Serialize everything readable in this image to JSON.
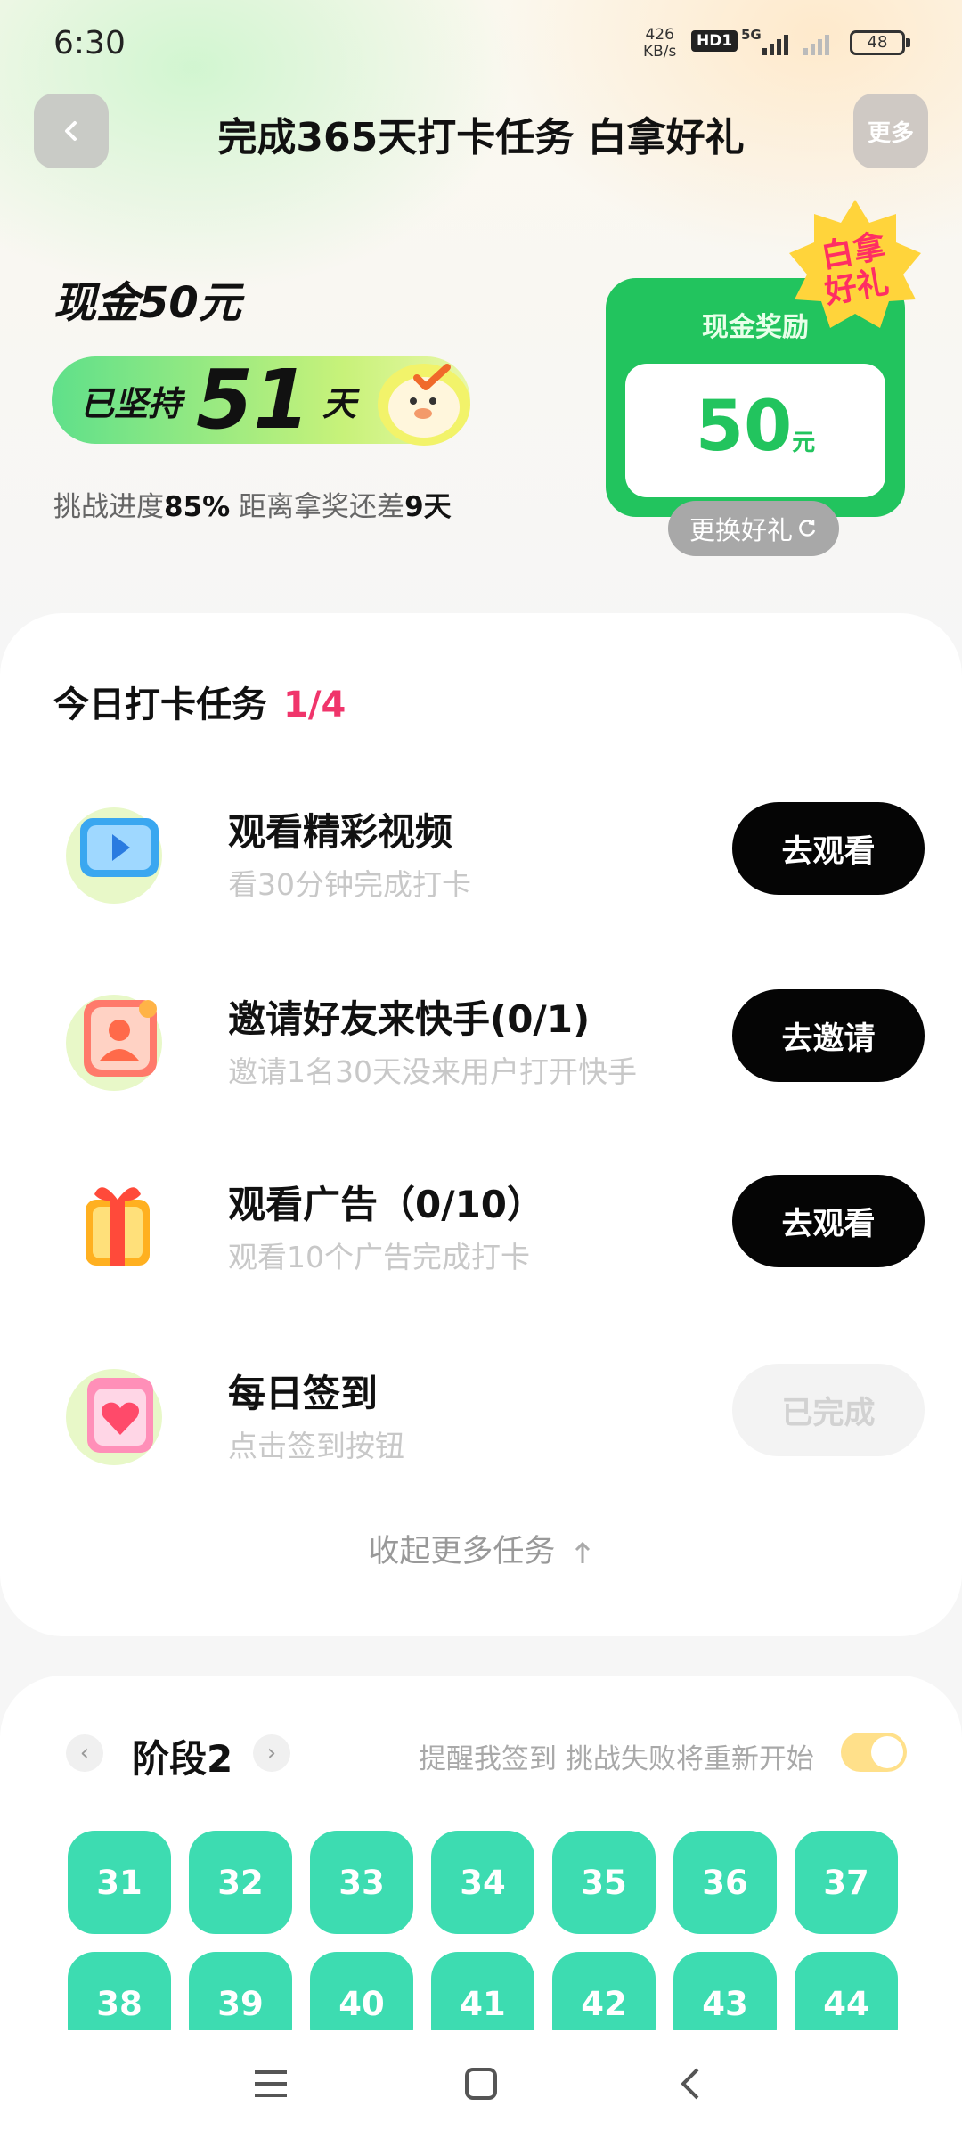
{
  "status_bar": {
    "time": "6:30",
    "net_speed_value": "426",
    "net_speed_unit": "KB/s",
    "hd_label": "HD1",
    "network_label": "5G",
    "battery": "48"
  },
  "header": {
    "title": "完成365天打卡任务 白拿好礼",
    "more_label": "更多"
  },
  "hero": {
    "cash_title": "现金50元",
    "streak_prefix": "已坚持",
    "streak_days": "51",
    "streak_suffix": "天",
    "progress_prefix": "挑战进度",
    "progress_percent": "85%",
    "progress_middle": " 距离拿奖还差",
    "days_left": "9天",
    "badge_line1": "白拿",
    "badge_line2": "好礼",
    "reward_label": "现金奖励",
    "reward_amount": "50",
    "reward_unit": "元",
    "switch_gift_label": "更换好礼"
  },
  "tasks": {
    "title": "今日打卡任务",
    "count": "1/4",
    "items": [
      {
        "title": "观看精彩视频",
        "subtitle": "看30分钟完成打卡",
        "button": "去观看"
      },
      {
        "title": "邀请好友来快手(0/1)",
        "subtitle": "邀请1名30天没来用户打开快手",
        "button": "去邀请"
      },
      {
        "title": "观看广告（0/10）",
        "subtitle": "观看10个广告完成打卡",
        "button": "去观看"
      },
      {
        "title": "每日签到",
        "subtitle": "点击签到按钮",
        "button": "已完成"
      }
    ],
    "collapse_label": "收起更多任务"
  },
  "stage": {
    "prev_icon": "‹",
    "title": "阶段2",
    "next_icon": "›",
    "remind_text": "提醒我签到 挑战失败将重新开始",
    "reminder_on": true,
    "days": [
      "31",
      "32",
      "33",
      "34",
      "35",
      "36",
      "37",
      "38",
      "39",
      "40",
      "41",
      "42",
      "43",
      "44"
    ]
  },
  "colors": {
    "accent_green": "#22c45e",
    "day_teal": "#3ddcb1",
    "count_pink": "#f0356b"
  },
  "icons": [
    "back-arrow-icon",
    "play-video-icon",
    "invite-user-icon",
    "gift-box-icon",
    "calendar-heart-icon",
    "refresh-icon",
    "arrow-up-icon",
    "menu-icon",
    "home-icon",
    "back-icon"
  ]
}
